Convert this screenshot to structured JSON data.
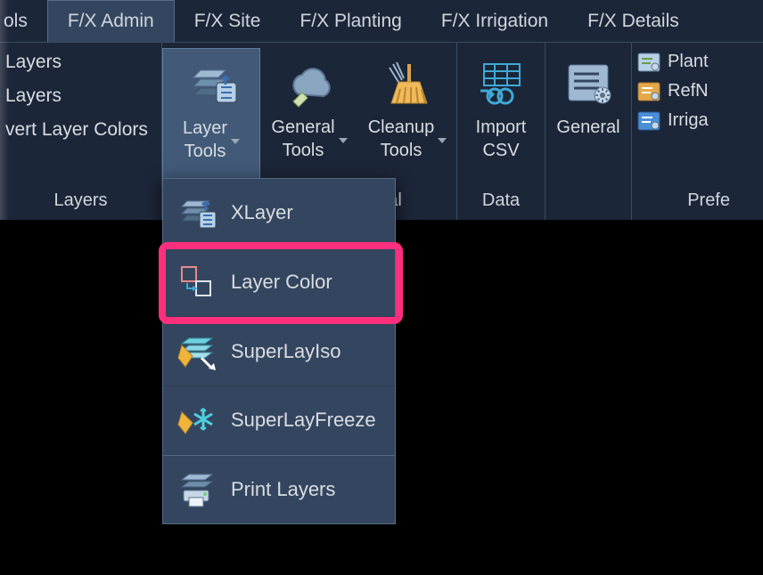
{
  "tabs": {
    "partial_left": "ols",
    "admin": "F/X Admin",
    "site": "F/X Site",
    "planting": "F/X Planting",
    "irrigation": "F/X Irrigation",
    "details": "F/X Details"
  },
  "layers_panel": {
    "item1": "Layers",
    "item2": "Layers",
    "item3": "vert Layer Colors",
    "title": "Layers"
  },
  "buttons": {
    "layer_tools": "Layer\nTools",
    "general_tools": "General\nTools",
    "cleanup_tools": "Cleanup\nTools",
    "import_csv": "Import\nCSV",
    "general": "General"
  },
  "panel_titles": {
    "behind_dropdown": "al",
    "data": "Data",
    "preferences": "Prefe"
  },
  "pref_items": {
    "planting": "Plant",
    "refnotes": "RefN",
    "irrigation": "Irriga"
  },
  "dropdown": {
    "xlayer": "XLayer",
    "layer_color": "Layer Color",
    "superlayiso": "SuperLayIso",
    "superlayfreeze": "SuperLayFreeze",
    "print_layers": "Print Layers"
  },
  "icons": {
    "layer_tools": "layer-tools-icon",
    "general_tools": "cloud-tools-icon",
    "cleanup_tools": "broom-icon",
    "import_csv": "import-csv-icon",
    "general": "settings-list-icon",
    "planting": "plant-pref-icon",
    "refnotes": "refnotes-pref-icon",
    "irrigation": "irrigation-pref-icon",
    "xlayer": "xlayer-icon",
    "layer_color": "layer-color-icon",
    "superlayiso": "superlayiso-icon",
    "superlayfreeze": "superlayfreeze-icon",
    "print_layers": "print-layers-icon"
  },
  "colors": {
    "bg": "#1b2638",
    "active_bg": "#34465f",
    "hover_bg": "#425a78",
    "border": "#556b86",
    "text": "#d8dde2",
    "highlight": "#ff2f7e"
  }
}
